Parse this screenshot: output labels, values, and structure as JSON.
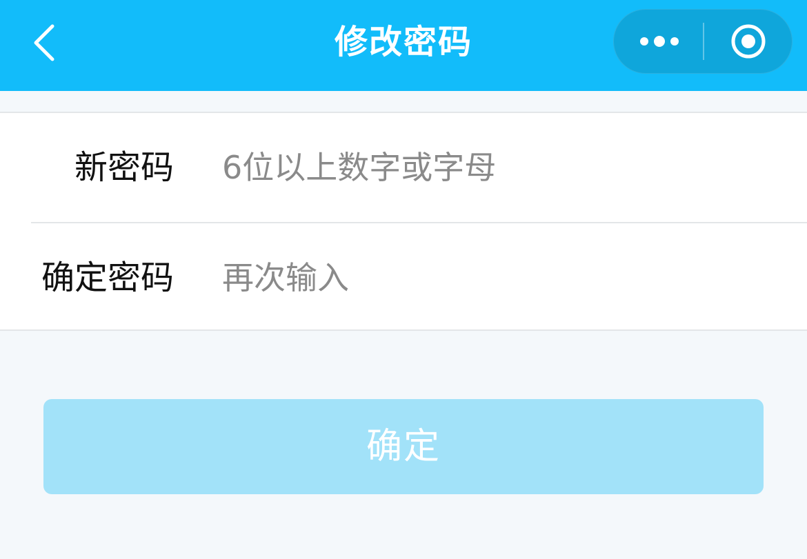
{
  "navbar": {
    "title": "修改密码",
    "back_icon": "chevron-left-icon",
    "more_icon": "more-dots-icon",
    "close_icon": "target-circle-icon",
    "background_color": "#12bcfa"
  },
  "form": {
    "new_password": {
      "label": "新密码",
      "value": "",
      "placeholder": "6位以上数字或字母"
    },
    "confirm_password": {
      "label": "确定密码",
      "value": "",
      "placeholder": "再次输入"
    }
  },
  "actions": {
    "confirm_label": "确定",
    "confirm_color": "#a2e2f9"
  }
}
